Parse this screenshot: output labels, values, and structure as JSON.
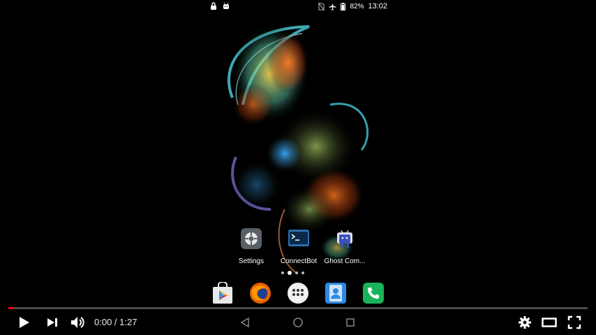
{
  "android": {
    "status_bar": {
      "left_icons": [
        "lock-icon",
        "android-debug-icon"
      ],
      "right_icons": [
        "no-sim-icon",
        "airplane-icon",
        "battery-icon"
      ],
      "battery": "82%",
      "time": "13:02"
    },
    "apps": [
      {
        "label": "Settings",
        "icon": "settings-icon"
      },
      {
        "label": "ConnectBot",
        "icon": "terminal-icon"
      },
      {
        "label": "Ghost Com...",
        "icon": "android-icon"
      }
    ],
    "dock": [
      "play-store-icon",
      "firefox-icon",
      "app-drawer-icon",
      "contacts-icon",
      "phone-icon"
    ],
    "page_dots": {
      "count": 4,
      "active": 1
    }
  },
  "player": {
    "progress": 0.0,
    "current_time": "0:00",
    "separator": " / ",
    "duration": "1:27",
    "accent": "#ff0000"
  }
}
